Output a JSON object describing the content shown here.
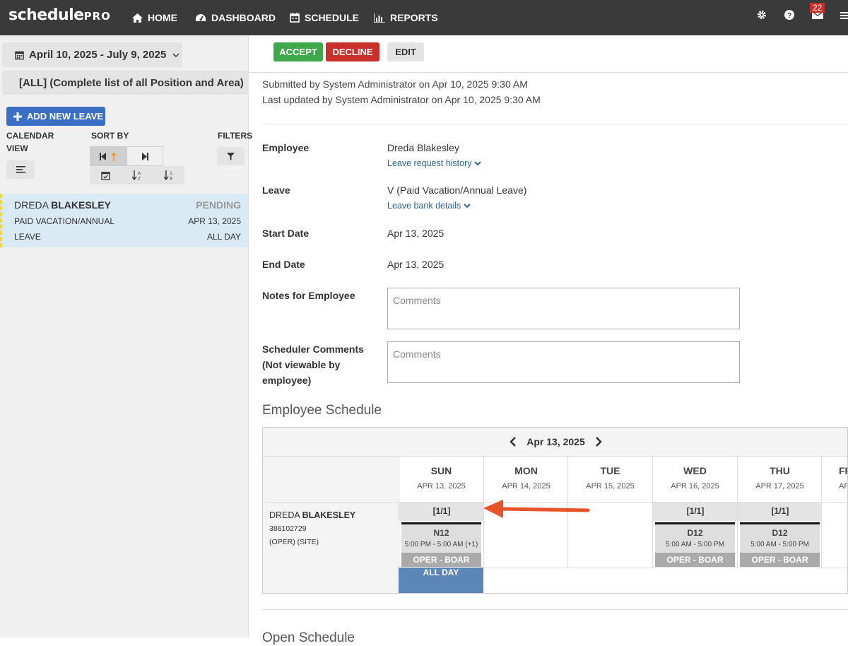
{
  "app": {
    "logo_main": "schedule",
    "logo_sub": "PRO"
  },
  "nav": {
    "home": "HOME",
    "dashboard": "DASHBOARD",
    "schedule": "SCHEDULE",
    "reports": "REPORTS",
    "messages_count": "22"
  },
  "sidebar": {
    "date_range": "April 10, 2025 - July 9, 2025",
    "position_filter": "[ALL] (Complete list of all Position and Area)",
    "add_leave": "ADD NEW LEAVE",
    "calendar_view_label_1": "CALENDAR",
    "calendar_view_label_2": "VIEW",
    "sort_by_label": "SORT BY",
    "filters_label": "FILTERS",
    "leave_item": {
      "first_name": "DREDA",
      "last_name": "BLAKESLEY",
      "status": "PENDING",
      "type_1": "PAID VACATION/ANNUAL",
      "type_2": "LEAVE",
      "date": "APR 13, 2025",
      "duration": "ALL DAY"
    }
  },
  "actions": {
    "accept": "ACCEPT",
    "decline": "DECLINE",
    "edit": "EDIT"
  },
  "request": {
    "submitted": "Submitted by System Administrator on Apr 10, 2025 9:30 AM",
    "updated": "Last updated by System Administrator on Apr 10, 2025 9:30 AM",
    "employee_label": "Employee",
    "employee": "Dreda Blakesley",
    "history_link": "Leave request history",
    "leave_label": "Leave",
    "leave": "V (Paid Vacation/Annual Leave)",
    "bank_link": "Leave bank details",
    "start_label": "Start Date",
    "start": "Apr 13, 2025",
    "end_label": "End Date",
    "end": "Apr 13, 2025",
    "notes_label": "Notes for Employee",
    "notes_placeholder": "Comments",
    "sched_label_1": "Scheduler Comments",
    "sched_label_2": "(Not viewable by",
    "sched_label_3": "employee)",
    "sched_placeholder": "Comments"
  },
  "schedule": {
    "title": "Employee Schedule",
    "current_date": "Apr 13, 2025",
    "days": [
      {
        "name": "SUN",
        "date": "APR 13, 2025"
      },
      {
        "name": "MON",
        "date": "APR 14, 2025"
      },
      {
        "name": "TUE",
        "date": "APR 15, 2025"
      },
      {
        "name": "WED",
        "date": "APR 16, 2025"
      },
      {
        "name": "THU",
        "date": "APR 17, 2025"
      },
      {
        "name": "FRI",
        "date": "AP"
      }
    ],
    "employee": {
      "first": "DREDA",
      "last": "BLAKESLEY",
      "id": "386102729",
      "area": "(OPER) (SITE)"
    },
    "shifts": [
      {
        "frac": "[1/1]",
        "code": "N12",
        "time": "5:00 PM - 5:00 AM (+1)",
        "area": "OPER - BOAR"
      },
      {
        "frac": "[1/1]",
        "code": "D12",
        "time": "5:00 AM - 5:00 PM",
        "area": "OPER - BOAR"
      },
      {
        "frac": "[1/1]",
        "code": "D12",
        "time": "5:00 AM - 5:00 PM",
        "area": "OPER - BOAR"
      }
    ],
    "all_day": "ALL DAY",
    "next_section": "Open Schedule"
  },
  "colors": {
    "accept": "#3ea84a",
    "decline": "#c9302c",
    "add_leave": "#3a6fc4",
    "all_day": "#5b87b8",
    "arrow": "#e8542a"
  }
}
